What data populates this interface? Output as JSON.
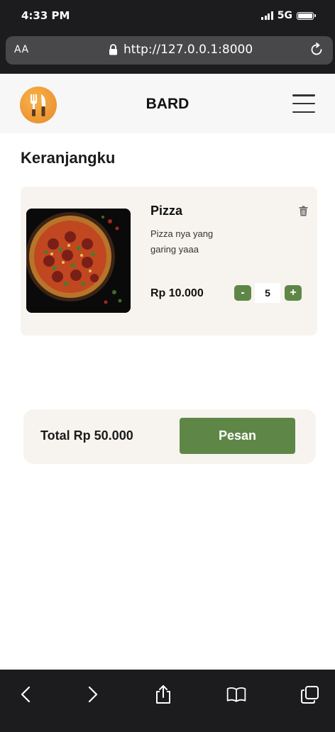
{
  "status_bar": {
    "time": "4:33 PM",
    "network": "5G"
  },
  "browser": {
    "text_size_label": "AA",
    "url": "http://127.0.0.1:8000"
  },
  "header": {
    "brand": "BARD",
    "logo_icon": "fork-knife-icon",
    "menu_icon": "hamburger-icon"
  },
  "cart": {
    "title": "Keranjangku",
    "items": [
      {
        "name": "Pizza",
        "description": "Pizza nya yang garing yaaa",
        "price": "Rp 10.000",
        "quantity": "5",
        "minus_label": "-",
        "plus_label": "+"
      }
    ]
  },
  "summary": {
    "total": "Total Rp 50.000",
    "order_label": "Pesan"
  },
  "colors": {
    "accent": "#5e8747",
    "card_bg": "#f7f4ef",
    "chrome": "#1c1c1e"
  },
  "toolbar": {
    "icons": [
      "back-icon",
      "forward-icon",
      "share-icon",
      "bookmarks-icon",
      "tabs-icon"
    ]
  }
}
